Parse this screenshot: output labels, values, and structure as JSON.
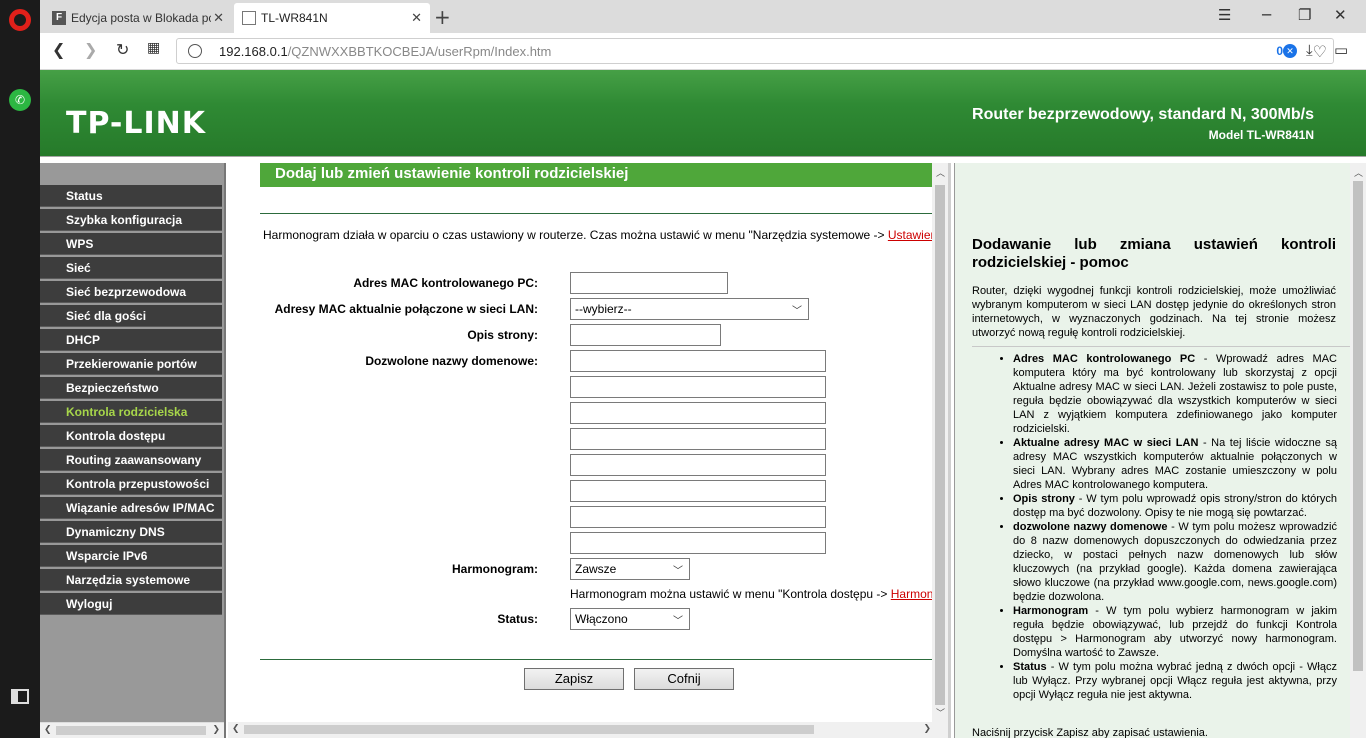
{
  "browser": {
    "tabs": [
      {
        "label": "Edycja posta w Blokada pc",
        "favicon": "F"
      },
      {
        "label": "TL-WR841N"
      }
    ],
    "url_host": "192.168.0.1",
    "url_path": "/QZNWXXBBTKOCBEJA/userRpm/Index.htm",
    "adblock_count": "0"
  },
  "header": {
    "brand": "TP-LINK",
    "tagline": "Router bezprzewodowy, standard N, 300Mb/s",
    "model": "Model TL-WR841N"
  },
  "menu": [
    "Status",
    "Szybka konfiguracja",
    "WPS",
    "Sieć",
    "Sieć bezprzewodowa",
    "Sieć dla gości",
    "DHCP",
    "Przekierowanie portów",
    "Bezpieczeństwo",
    "Kontrola rodzicielska",
    "Kontrola dostępu",
    "Routing zaawansowany",
    "Kontrola przepustowości",
    "Wiązanie adresów IP/MAC",
    "Dynamiczny DNS",
    "Wsparcie IPv6",
    "Narzędzia systemowe",
    "Wyloguj"
  ],
  "menu_active": "Kontrola rodzicielska",
  "form": {
    "title": "Dodaj lub zmień ustawienie kontroli rodzicielskiej",
    "info_text": "Harmonogram działa w oparciu o czas ustawiony w routerze. Czas można ustawić w menu \"Narzędzia systemowe -> ",
    "info_link": "Ustawienia czasu",
    "mac_label": "Adres MAC kontrolowanego PC:",
    "mac_value": "",
    "lan_label": "Adresy MAC aktualnie połączone w sieci LAN:",
    "lan_value": "--wybierz--",
    "desc_label": "Opis strony:",
    "desc_value": "",
    "domains_label": "Dozwolone nazwy domenowe:",
    "domains": [
      "",
      "",
      "",
      "",
      "",
      "",
      "",
      ""
    ],
    "schedule_label": "Harmonogram:",
    "schedule_value": "Zawsze",
    "schedule_note": "Harmonogram można ustawić w menu \"Kontrola dostępu -> ",
    "schedule_link": "Harmonogram",
    "status_label": "Status:",
    "status_value": "Włączono",
    "save_label": "Zapisz",
    "cancel_label": "Cofnij"
  },
  "help": {
    "title": "Dodawanie lub zmiana ustawień kontroli rodzicielskiej - pomoc",
    "intro": "Router, dzięki wygodnej funkcji kontroli rodzicielskiej, może umożliwiać wybranym komputerom w sieci LAN dostęp jedynie do określonych stron internetowych, w wyznaczonych godzinach. Na tej stronie możesz utworzyć nową regułę kontroli rodzicielskiej.",
    "items": [
      {
        "term": "Adres MAC kontrolowanego PC",
        "text": " - Wprowadź adres MAC komputera który ma być kontrolowany lub skorzystaj z opcji Aktualne adresy MAC w sieci LAN. Jeżeli zostawisz to pole puste, reguła będzie obowiązywać dla wszystkich komputerów w sieci LAN z wyjątkiem komputera zdefiniowanego jako komputer rodzicielski."
      },
      {
        "term": "Aktualne adresy MAC w sieci LAN",
        "text": " - Na tej liście widoczne są adresy MAC wszystkich komputerów aktualnie połączonych w sieci LAN. Wybrany adres MAC zostanie umieszczony w polu Adres MAC kontrolowanego komputera."
      },
      {
        "term": "Opis strony",
        "text": " - W tym polu wprowadź opis strony/stron do których dostęp ma być dozwolony. Opisy te nie mogą się powtarzać."
      },
      {
        "term": "dozwolone nazwy domenowe",
        "text": " - W tym polu możesz wprowadzić do 8 nazw domenowych dopuszczonych do odwiedzania przez dziecko, w postaci pełnych nazw domenowych lub słów kluczowych (na przykład google). Każda domena zawierająca słowo kluczowe (na przykład www.google.com, news.google.com) będzie dozwolona."
      },
      {
        "term": "Harmonogram",
        "text": " - W tym polu wybierz harmonogram w jakim reguła będzie obowiązywać, lub przejdź do funkcji Kontrola dostępu > Harmonogram aby utworzyć nowy harmonogram. Domyślna wartość to Zawsze."
      },
      {
        "term": "Status",
        "text": " - W tym polu można wybrać jedną z dwóch opcji - Włącz lub Wyłącz. Przy wybranej opcji Włącz reguła jest aktywna, przy opcji Wyłącz reguła nie jest aktywna."
      }
    ],
    "outro": "Naciśnij przycisk Zapisz aby zapisać ustawienia."
  },
  "colors": {
    "header_green": "#2f8a34",
    "title_bar_green": "#4fa73a",
    "menu_bg": "#3d3d3d",
    "menu_active": "#a7d64a",
    "help_bg": "#eaf3ea"
  },
  "icons": [
    "opera-logo-icon",
    "whatsapp-icon",
    "sidebar-panel-icon",
    "back-icon",
    "forward-icon",
    "reload-icon",
    "tabs-grid-icon",
    "globe-icon",
    "adblock-icon",
    "heart-icon",
    "download-icon",
    "battery-icon",
    "minimize-icon",
    "maximize-icon",
    "close-icon",
    "tab-menu-icon"
  ]
}
